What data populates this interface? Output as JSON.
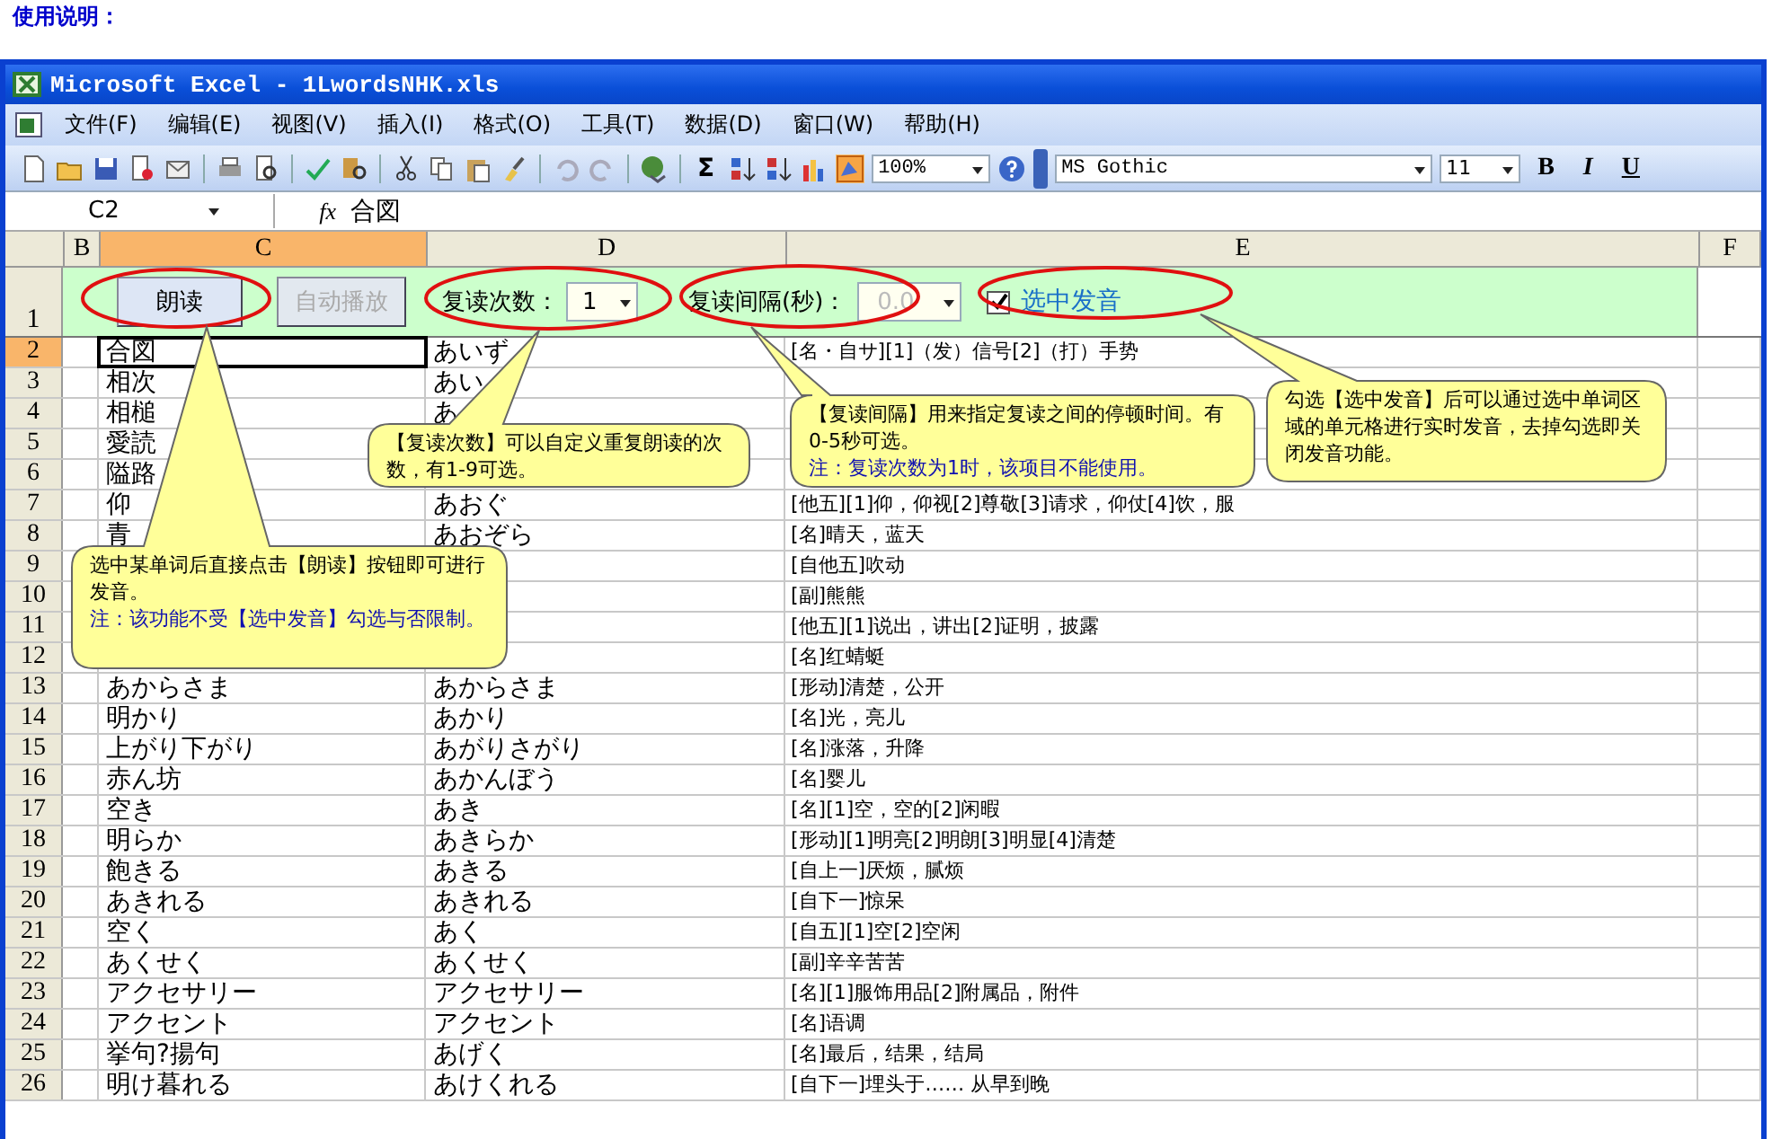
{
  "caption": "使用说明：",
  "window": {
    "title": "Microsoft Excel - 1LwordsNHK.xls"
  },
  "menu": [
    "文件(F)",
    "编辑(E)",
    "视图(V)",
    "插入(I)",
    "格式(O)",
    "工具(T)",
    "数据(D)",
    "窗口(W)",
    "帮助(H)"
  ],
  "toolbar": {
    "sigma": "Σ",
    "zoom": "100%",
    "font": "MS Gothic",
    "size": "11",
    "format_buttons": [
      "B",
      "I",
      "U"
    ]
  },
  "formula_bar": {
    "name_box": "C2",
    "fx": "fx",
    "formula": "合図"
  },
  "columns": [
    {
      "label": "B",
      "selected": false
    },
    {
      "label": "C",
      "selected": true
    },
    {
      "label": "D",
      "selected": false
    },
    {
      "label": "E",
      "selected": false
    },
    {
      "label": "F",
      "selected": false
    }
  ],
  "controls": {
    "row_number": "1",
    "read_button": {
      "label": "朗读",
      "disabled": false
    },
    "auto_button": {
      "label": "自动播放",
      "disabled": true
    },
    "repeat_label": "复读次数：",
    "repeat_value": "1",
    "interval_label": "复读间隔(秒)：",
    "interval": {
      "value": "0.0",
      "disabled": true
    },
    "voice": {
      "label": "选中发音",
      "checked": true
    }
  },
  "rows": [
    {
      "number": "2",
      "selected": true,
      "c": "合図",
      "d": "あいず",
      "e": "[名・自サ][1]（发）信号[2]（打）手势"
    },
    {
      "number": "3",
      "selected": false,
      "c": "相次",
      "d": "あい"
    },
    {
      "number": "4",
      "selected": false,
      "c": "相槌",
      "d": "あ"
    },
    {
      "number": "5",
      "selected": false,
      "c": "愛読"
    },
    {
      "number": "6",
      "selected": false,
      "c": "隘路"
    },
    {
      "number": "7",
      "selected": false,
      "c": "仰",
      "d": "あおぐ",
      "e": "[他五][1]仰，仰视[2]尊敬[3]请求，仰仗[4]饮，服"
    },
    {
      "number": "8",
      "selected": false,
      "c": "青",
      "d": "あおぞら",
      "e": "[名]晴天，蓝天"
    },
    {
      "number": "9",
      "selected": false,
      "e": "[自他五]吹动"
    },
    {
      "number": "10",
      "selected": false,
      "e": "[副]熊熊"
    },
    {
      "number": "11",
      "selected": false,
      "e": "[他五][1]说出，讲出[2]证明，披露"
    },
    {
      "number": "12",
      "selected": false,
      "e": "[名]红蜻蜓"
    },
    {
      "number": "13",
      "selected": false,
      "c": "あからさま",
      "d": "あからさま",
      "e": "[形动]清楚，公开"
    },
    {
      "number": "14",
      "selected": false,
      "c": "明かり",
      "d": "あかり",
      "e": "[名]光，亮儿"
    },
    {
      "number": "15",
      "selected": false,
      "c": "上がり下がり",
      "d": "あがりさがり",
      "e": "[名]涨落，升降"
    },
    {
      "number": "16",
      "selected": false,
      "c": "赤ん坊",
      "d": "あかんぼう",
      "e": "[名]婴儿"
    },
    {
      "number": "17",
      "selected": false,
      "c": "空き",
      "d": "あき",
      "e": "[名][1]空，空的[2]闲暇"
    },
    {
      "number": "18",
      "selected": false,
      "c": "明らか",
      "d": "あきらか",
      "e": "[形动][1]明亮[2]明朗[3]明显[4]清楚"
    },
    {
      "number": "19",
      "selected": false,
      "c": "飽きる",
      "d": "あきる",
      "e": "[自上一]厌烦，腻烦"
    },
    {
      "number": "20",
      "selected": false,
      "c": "あきれる",
      "d": "あきれる",
      "e": "[自下一]惊呆"
    },
    {
      "number": "21",
      "selected": false,
      "c": "空く",
      "d": "あく",
      "e": "[自五][1]空[2]空闲"
    },
    {
      "number": "22",
      "selected": false,
      "c": "あくせく",
      "d": "あくせく",
      "e": "[副]辛辛苦苦"
    },
    {
      "number": "23",
      "selected": false,
      "c": "アクセサリー",
      "d": "アクセサリー",
      "e": "[名][1]服饰用品[2]附属品，附件"
    },
    {
      "number": "24",
      "selected": false,
      "c": "アクセント",
      "d": "アクセント",
      "e": "[名]语调"
    },
    {
      "number": "25",
      "selected": false,
      "c": "挙句?揚句",
      "d": "あげく",
      "e": "[名]最后，结果，结局"
    },
    {
      "number": "26",
      "selected": false,
      "c": "明け暮れる",
      "d": "あけくれる",
      "e": "[自下一]埋头于…… 从早到晚"
    }
  ],
  "callouts": [
    {
      "text": "选中某单词后直接点击【朗读】按钮即可进行发音。",
      "note": "注：该功能不受【选中发音】勾选与否限制。"
    },
    {
      "text": "【复读次数】可以自定义重复朗读的次数，有1-9可选。"
    },
    {
      "text": "【复读间隔】用来指定复读之间的停顿时间。有0-5秒可选。",
      "note": "注：复读次数为1时，该项目不能使用。"
    },
    {
      "text": "勾选【选中发音】后可以通过选中单词区域的单元格进行实时发音，去掉勾选即关闭发音功能。"
    }
  ]
}
